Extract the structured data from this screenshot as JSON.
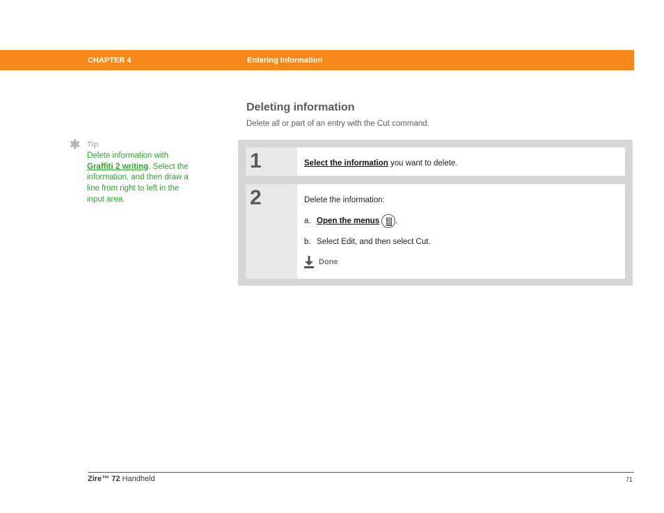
{
  "header": {
    "chapter": "CHAPTER 4",
    "chapter_title": "Entering Information",
    "bar_color": "#f7891a"
  },
  "tip": {
    "icon": "asterisk-icon",
    "label": "Tip",
    "text_before": "Delete information with ",
    "link": "Graffiti 2 writing",
    "text_after": ". Select the information, and then draw a line from right to left in the input area.",
    "color": "#2ba12b"
  },
  "section": {
    "title": "Deleting information",
    "subtitle": "Delete all or part of an entry with the Cut command."
  },
  "steps": [
    {
      "number": "1",
      "link": "Select the information",
      "text": " you want to delete."
    },
    {
      "number": "2",
      "intro": "Delete the information:",
      "substeps": [
        {
          "marker": "a.",
          "link": "Open the menus",
          "icon": "menu-icon",
          "after": "."
        },
        {
          "marker": "b.",
          "text": "Select Edit, and then select Cut."
        }
      ],
      "done_label": "Done"
    }
  ],
  "footer": {
    "product_name": "Zire™ 72",
    "product_suffix": " Handheld",
    "page_number": "71"
  }
}
